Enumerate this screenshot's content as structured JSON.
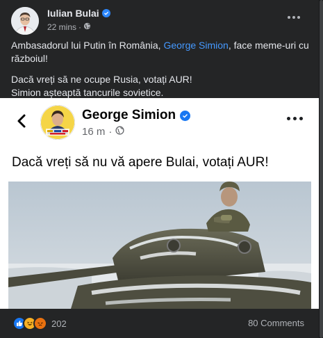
{
  "post": {
    "author": "Iulian Bulai",
    "time": "22 mins",
    "paragraph1_pre": "Ambasadorul lui Putin în România, ",
    "paragraph1_link": "George Simion",
    "paragraph1_post": ", face meme-uri cu războiul!",
    "paragraph2_line1": "Dacă vreți să ne ocupe Rusia, votați AUR!",
    "paragraph2_line2": "Simion așteaptă tancurile sovietice."
  },
  "shared": {
    "author": "George Simion",
    "time": "16 m",
    "text": "Dacă vreți să nu vă apere Bulai, votați AUR!",
    "avatar_caption": "AUR pentru ROMANIA"
  },
  "footer": {
    "reaction_count": "202",
    "comments": "80 Comments"
  },
  "colors": {
    "background": "#242526",
    "link": "#4599ff",
    "verified": "#2d88ff"
  },
  "icons": [
    "verified-badge-icon",
    "globe-icon",
    "more-icon",
    "back-arrow-icon",
    "like-reaction-icon",
    "haha-reaction-icon",
    "angry-reaction-icon"
  ]
}
